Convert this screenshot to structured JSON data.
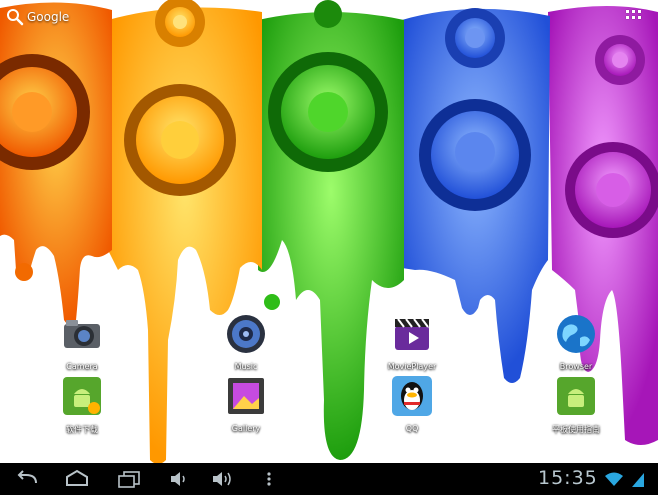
{
  "search": {
    "label": "Google",
    "icon": "search-icon"
  },
  "apps": [
    {
      "id": "camera",
      "label": "Camera",
      "icon": "camera-icon"
    },
    {
      "id": "music",
      "label": "Music",
      "icon": "music-icon"
    },
    {
      "id": "movieplayer",
      "label": "MoviePlayer",
      "icon": "movie-clapper-icon"
    },
    {
      "id": "browser",
      "label": "Browser",
      "icon": "globe-icon"
    },
    {
      "id": "software-download",
      "label": "软件下载",
      "icon": "android-download-icon"
    },
    {
      "id": "gallery",
      "label": "Gallery",
      "icon": "gallery-icon"
    },
    {
      "id": "qq",
      "label": "QQ",
      "icon": "qq-penguin-icon"
    },
    {
      "id": "user-guide",
      "label": "平板使用指南",
      "icon": "android-guide-icon"
    }
  ],
  "status": {
    "time": "15:35"
  },
  "colors": {
    "orange": "#f26a00",
    "yellow": "#ffb300",
    "green": "#2fbd18",
    "blue": "#2f6ee8",
    "magenta": "#c21fcf",
    "navbar": "#000000",
    "clock": "#b8c7cf"
  }
}
